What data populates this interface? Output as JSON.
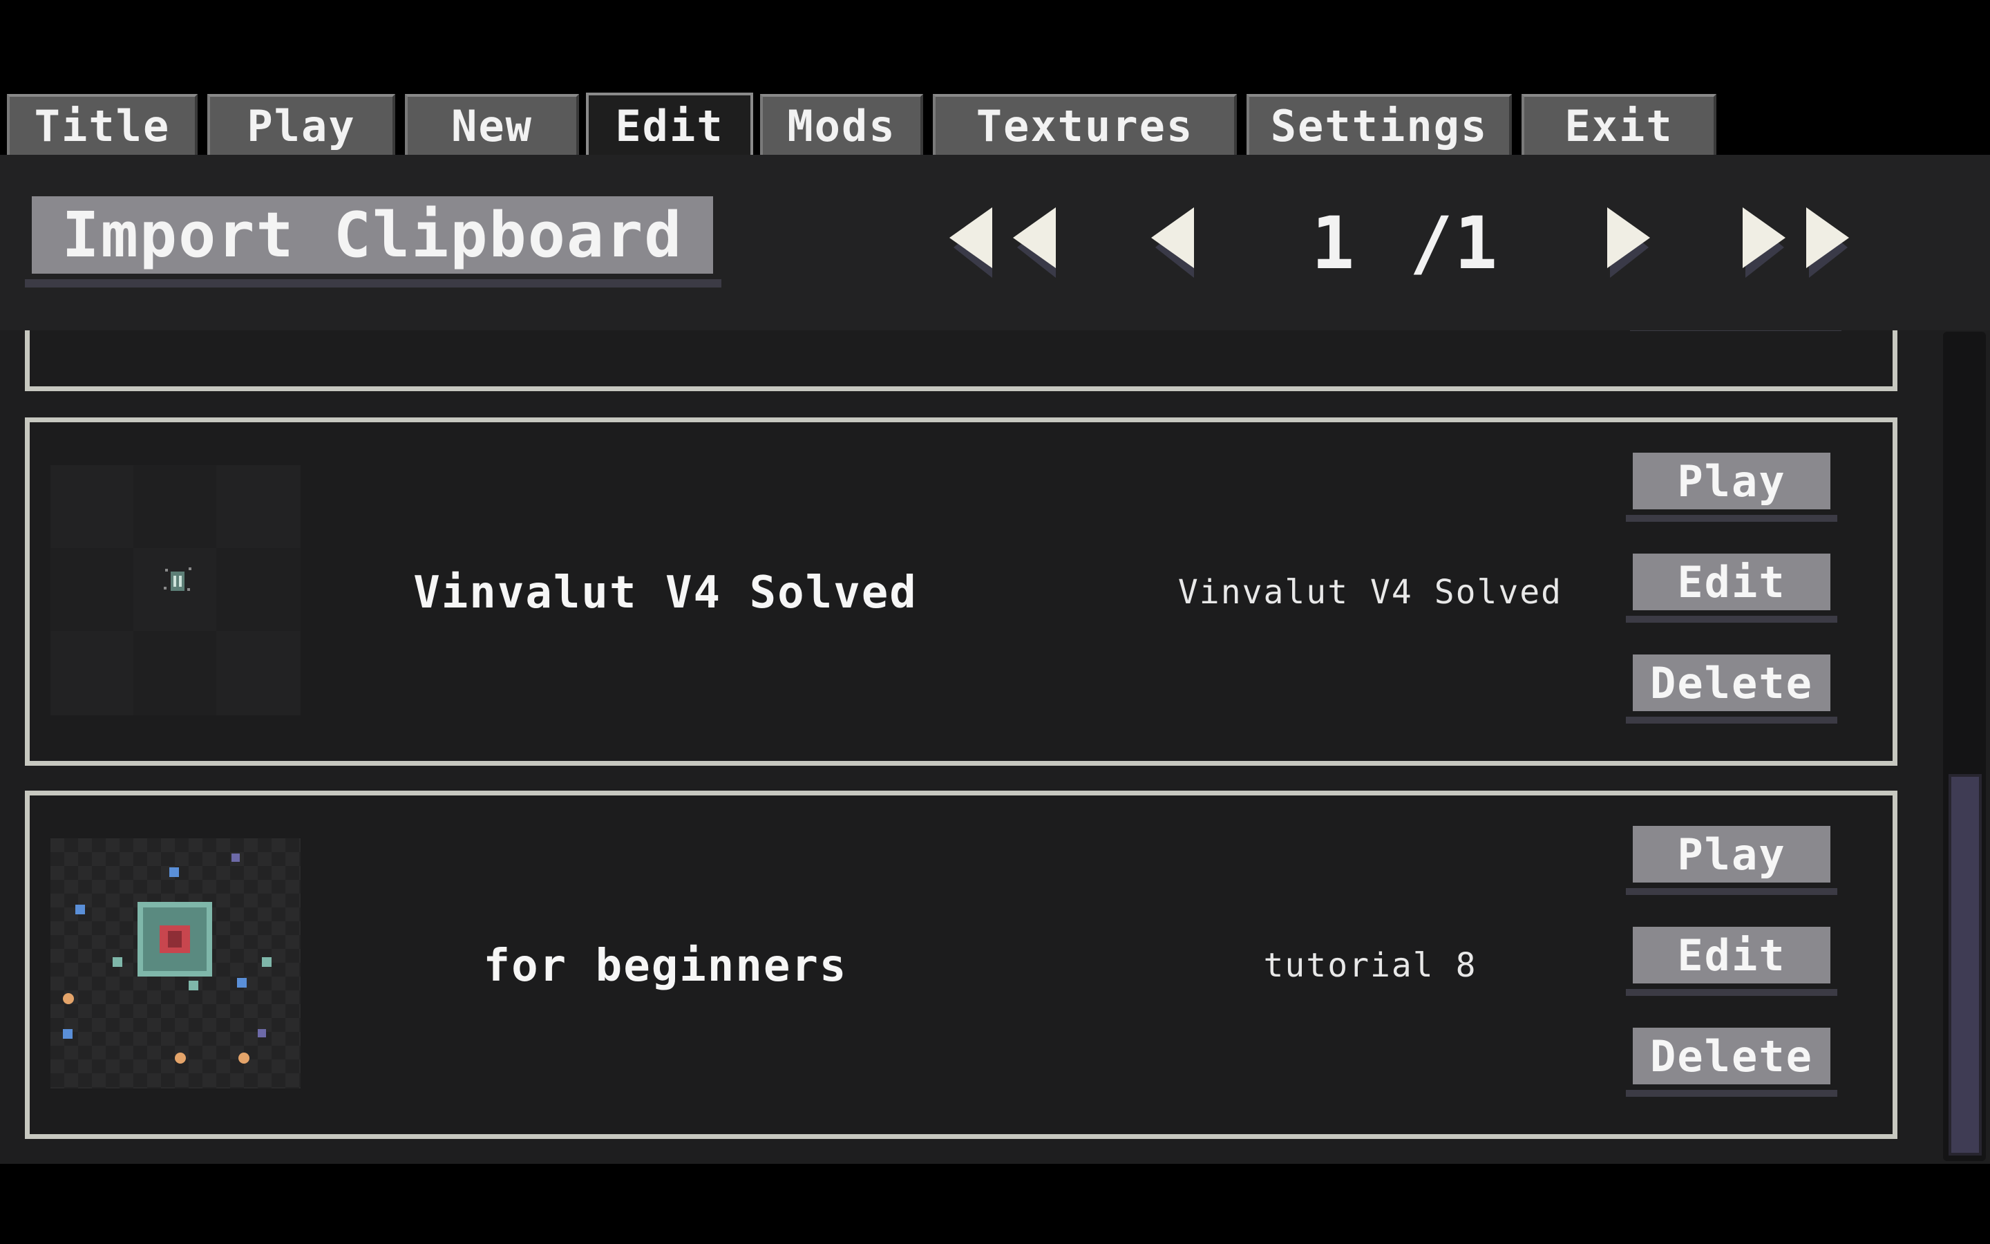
{
  "tabs": [
    {
      "label": "Title",
      "active": false
    },
    {
      "label": "Play",
      "active": false
    },
    {
      "label": "New",
      "active": false
    },
    {
      "label": "Edit",
      "active": true
    },
    {
      "label": "Mods",
      "active": false
    },
    {
      "label": "Textures",
      "active": false
    },
    {
      "label": "Settings",
      "active": false
    },
    {
      "label": "Exit",
      "active": false
    }
  ],
  "toolbar": {
    "import_label": "Import Clipboard",
    "page_current": "1",
    "page_total": "/1",
    "icons": [
      "first-page-icon",
      "previous-page-icon",
      "next-page-icon",
      "last-page-icon"
    ]
  },
  "levels": [
    {
      "name": "Vinvalut V4 Solved",
      "description": "Vinvalut V4 Solved",
      "buttons": {
        "play": "Play",
        "edit": "Edit",
        "delete": "Delete"
      }
    },
    {
      "name": "for beginners",
      "description": "tutorial 8",
      "buttons": {
        "play": "Play",
        "edit": "Edit",
        "delete": "Delete"
      }
    }
  ],
  "colors": {
    "button": "#8a898e",
    "panel": "#1e1e1f",
    "card_border": "#c7c8c0",
    "arrow": "#f0eee4",
    "scroll_thumb": "#3f3c54"
  }
}
